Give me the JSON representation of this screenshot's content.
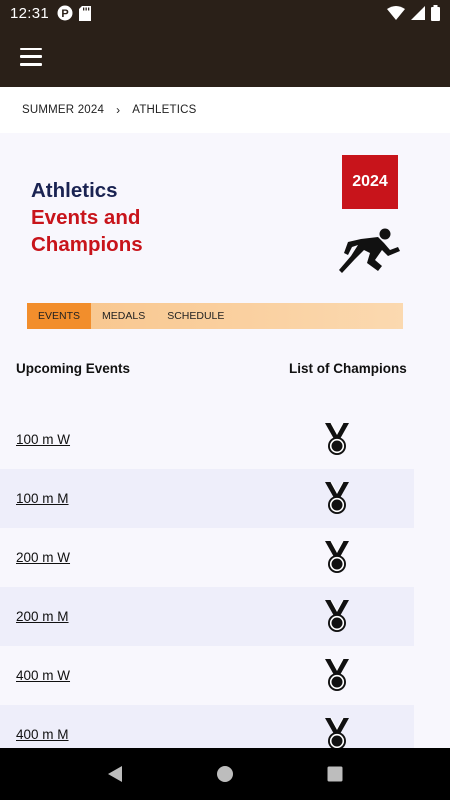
{
  "status_bar": {
    "time": "12:31"
  },
  "breadcrumb": {
    "parent": "SUMMER 2024",
    "separator": "›",
    "current": "ATHLETICS"
  },
  "hero": {
    "title_line1": "Athletics",
    "title_line2": "Events and",
    "title_line3": "Champions",
    "year_badge": "2024"
  },
  "tabs": [
    {
      "label": "EVENTS",
      "active": true
    },
    {
      "label": "MEDALS",
      "active": false
    },
    {
      "label": "SCHEDULE",
      "active": false
    }
  ],
  "columns": {
    "left": "Upcoming Events",
    "right": "List of Champions"
  },
  "events": [
    {
      "name": "100 m W"
    },
    {
      "name": "100 m M"
    },
    {
      "name": "200 m W"
    },
    {
      "name": "200 m M"
    },
    {
      "name": "400 m W"
    },
    {
      "name": "400 m M"
    }
  ],
  "colors": {
    "app_bar": "#2a2018",
    "title_dark": "#1a2352",
    "title_red": "#c8141b",
    "tab_active": "#f28e2c",
    "tab_bar": "#f8c48a"
  }
}
